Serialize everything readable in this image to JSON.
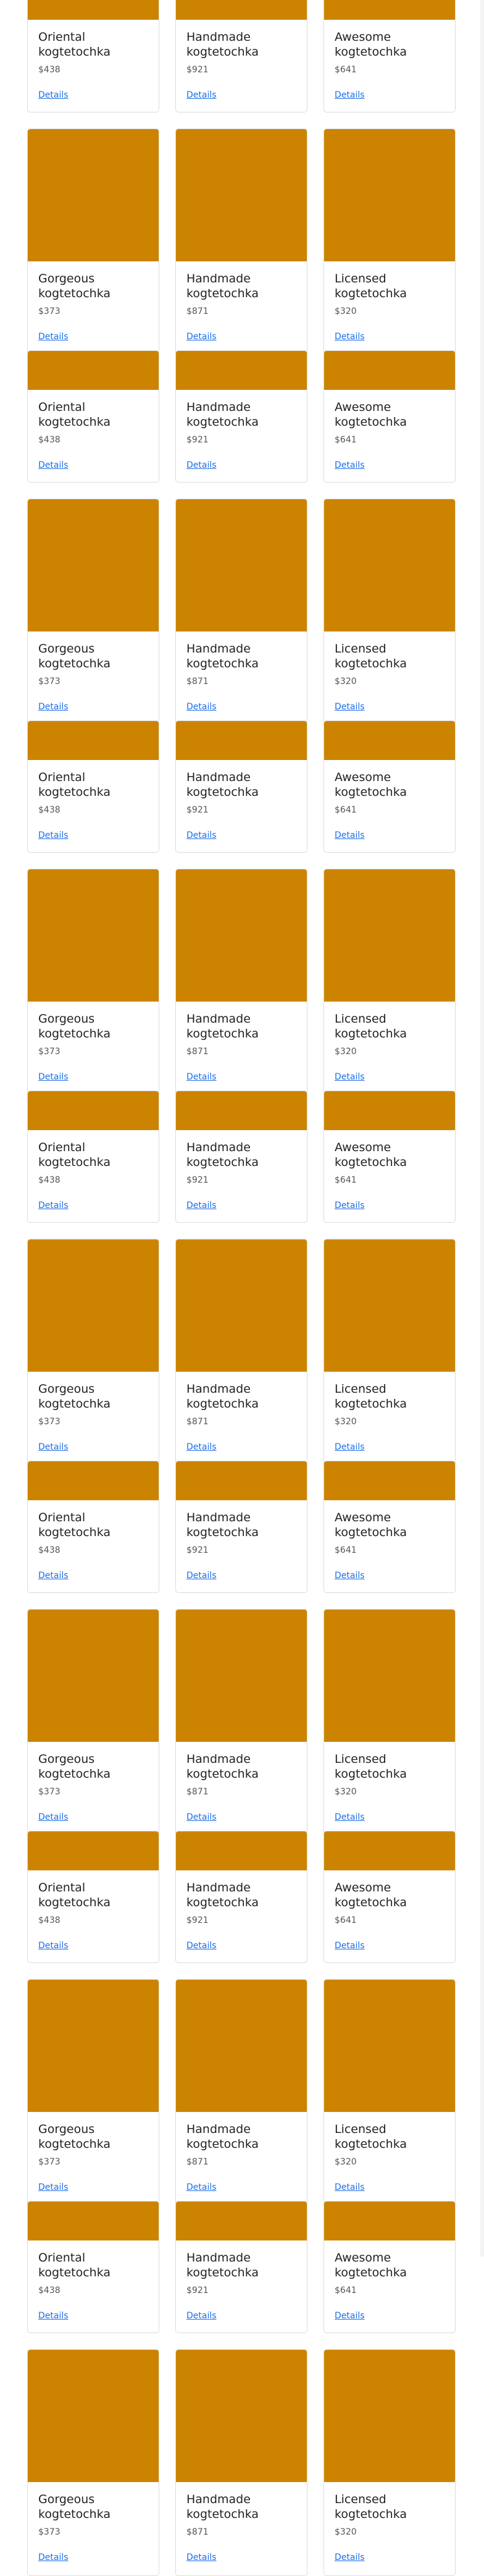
{
  "product_pattern": [
    [
      {
        "title": "Oriental kogtetochka",
        "price": "$438",
        "link": "Details"
      },
      {
        "title": "Handmade kogtetochka",
        "price": "$921",
        "link": "Details"
      },
      {
        "title": "Awesome kogtetochka",
        "price": "$641",
        "link": "Details"
      }
    ],
    [
      {
        "title": "Gorgeous kogtetochka",
        "price": "$373",
        "link": "Details"
      },
      {
        "title": "Handmade kogtetochka",
        "price": "$871",
        "link": "Details"
      },
      {
        "title": "Licensed kogtetochka",
        "price": "$320",
        "link": "Details"
      }
    ]
  ],
  "image_color": "#cc8400",
  "link_color": "#1a6ee8"
}
